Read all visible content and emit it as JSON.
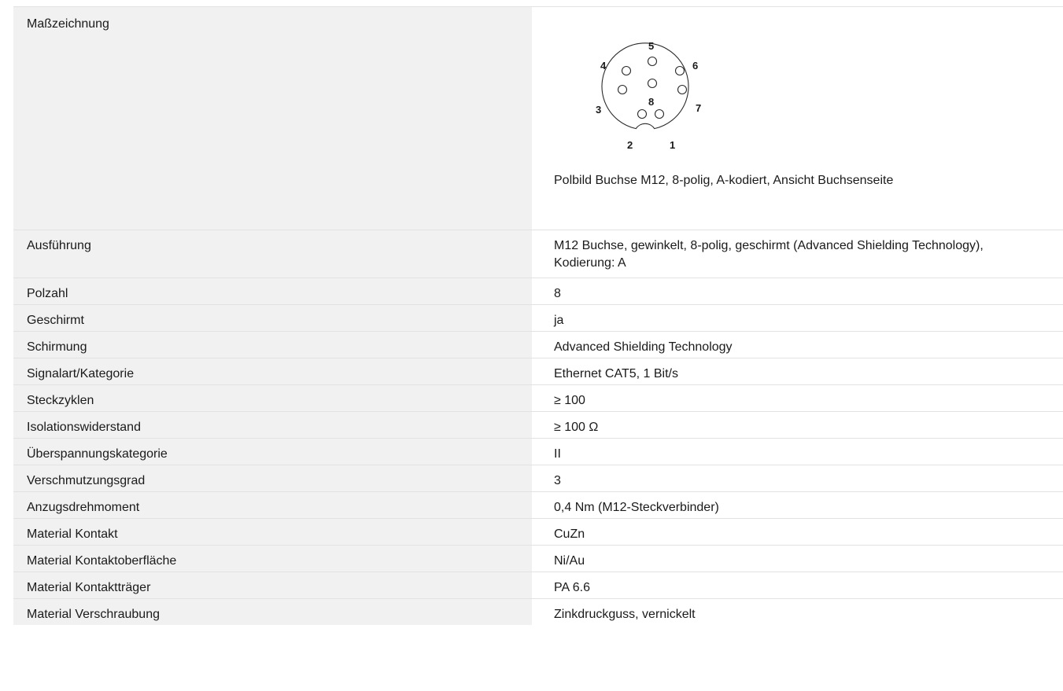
{
  "drawing": {
    "label": "Maßzeichnung",
    "caption": "Polbild Buchse M12, 8-polig, A-kodiert, Ansicht Buchsenseite",
    "pins": [
      "1",
      "2",
      "3",
      "4",
      "5",
      "6",
      "7",
      "8"
    ]
  },
  "specs": [
    {
      "label": "Ausführung",
      "value": "M12 Buchse, gewinkelt, 8-polig, geschirmt (Advanced Shielding Technology), Kodierung: A"
    },
    {
      "label": "Polzahl",
      "value": "8"
    },
    {
      "label": "Geschirmt",
      "value": "ja"
    },
    {
      "label": "Schirmung",
      "value": "Advanced Shielding Technology"
    },
    {
      "label": "Signalart/Kategorie",
      "value": "Ethernet CAT5, 1 Bit/s"
    },
    {
      "label": "Steckzyklen",
      "value": "≥ 100"
    },
    {
      "label": "Isolationswiderstand",
      "value": "≥ 100 Ω"
    },
    {
      "label": "Überspannungskategorie",
      "value": "II"
    },
    {
      "label": "Verschmutzungsgrad",
      "value": "3"
    },
    {
      "label": "Anzugsdrehmoment",
      "value": "0,4 Nm (M12-Steckverbinder)"
    },
    {
      "label": "Material Kontakt",
      "value": "CuZn"
    },
    {
      "label": "Material Kontaktoberfläche",
      "value": "Ni/Au"
    },
    {
      "label": "Material Kontaktträger",
      "value": "PA 6.6"
    },
    {
      "label": "Material Verschraubung",
      "value": "Zinkdruckguss, vernickelt"
    }
  ]
}
